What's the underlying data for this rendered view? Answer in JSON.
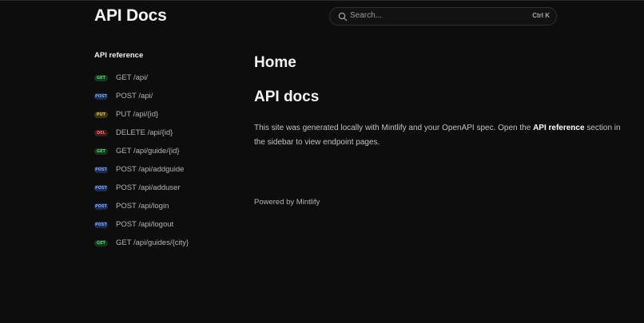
{
  "header": {
    "logo": "API Docs",
    "search_placeholder": "Search...",
    "search_shortcut": "Ctrl K"
  },
  "sidebar": {
    "section_title": "API reference",
    "items": [
      {
        "method": "GET",
        "path": "GET /api/"
      },
      {
        "method": "POST",
        "path": "POST /api/"
      },
      {
        "method": "PUT",
        "path": "PUT /api/{id}"
      },
      {
        "method": "DEL",
        "path": "DELETE /api/{id}"
      },
      {
        "method": "GET",
        "path": "GET /api/guide/{id}"
      },
      {
        "method": "POST",
        "path": "POST /api/addguide"
      },
      {
        "method": "POST",
        "path": "POST /api/adduser"
      },
      {
        "method": "POST",
        "path": "POST /api/login"
      },
      {
        "method": "POST",
        "path": "POST /api/logout"
      },
      {
        "method": "GET",
        "path": "GET /api/guides/{city}"
      }
    ]
  },
  "main": {
    "title": "Home",
    "heading": "API docs",
    "paragraph_before": "This site was generated locally with Mintlify and your OpenAPI spec. Open the ",
    "paragraph_bold": "API reference",
    "paragraph_after": " section in the sidebar to view endpoint pages.",
    "footer": "Powered by Mintlify"
  },
  "colors": {
    "GET": {
      "bg": "#16361f",
      "fg": "#5bd17a"
    },
    "POST": {
      "bg": "#1d2d52",
      "fg": "#7fa3ef"
    },
    "PUT": {
      "bg": "#3d3412",
      "fg": "#e2be45"
    },
    "DEL": {
      "bg": "#44191a",
      "fg": "#ec6a6a"
    }
  }
}
